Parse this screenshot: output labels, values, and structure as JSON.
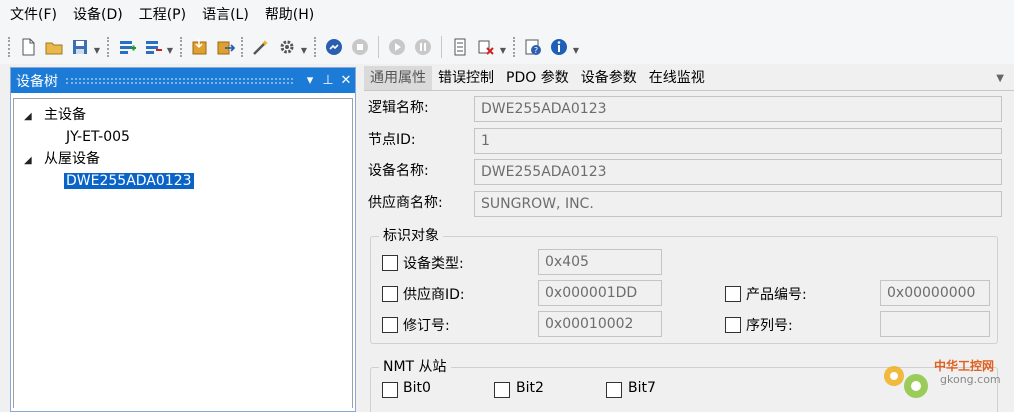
{
  "menu": [
    "文件(F)",
    "设备(D)",
    "工程(P)",
    "语言(L)",
    "帮助(H)"
  ],
  "tree_panel": {
    "title": "设备树",
    "items": [
      "主设备",
      "JY-ET-005",
      "从屋设备",
      "DWE255ADA0123"
    ]
  },
  "tabs": [
    "通用属性",
    "错误控制",
    "PDO 参数",
    "设备参数",
    "在线监视"
  ],
  "general": {
    "logic_name_label": "逻辑名称:",
    "logic_name": "DWE255ADA0123",
    "node_id_label": "节点ID:",
    "node_id": "1",
    "device_name_label": "设备名称:",
    "device_name": "DWE255ADA0123",
    "vendor_name_label": "供应商名称:",
    "vendor_name": "SUNGROW, INC."
  },
  "identity": {
    "title": "标识对象",
    "device_type_label": "设备类型:",
    "device_type": "0x405",
    "vendor_id_label": "供应商ID:",
    "vendor_id": "0x000001DD",
    "product_code_label": "产品编号:",
    "product_code": "0x00000000",
    "revision_label": "修订号:",
    "revision": "0x00010002",
    "serial_label": "序列号:",
    "serial": ""
  },
  "nmt": {
    "title": "NMT 从站",
    "bits": [
      "Bit0",
      "Bit2",
      "Bit7"
    ]
  },
  "watermark": {
    "cn": "中华工控网",
    "url": "gkong.com"
  },
  "colors": {
    "panel_header": "#1d7bd8",
    "selection": "#0a64c8"
  }
}
